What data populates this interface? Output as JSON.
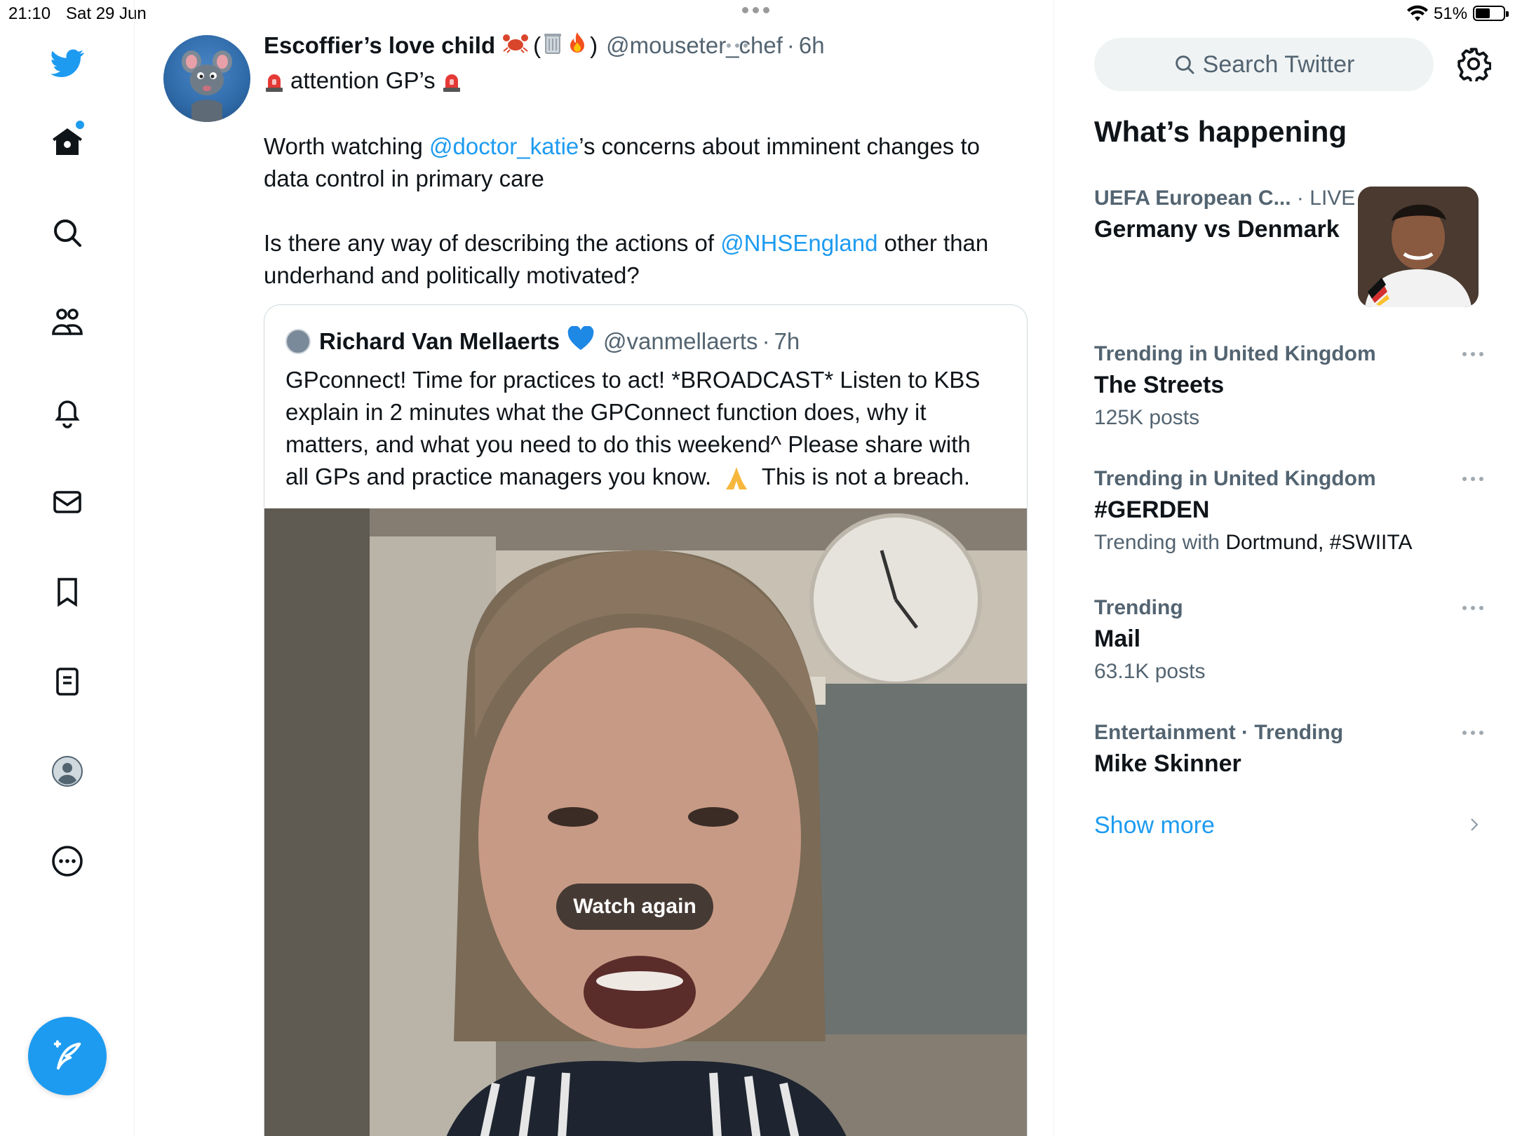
{
  "status_bar": {
    "time": "21:10",
    "date": "Sat 29 Jun",
    "battery": "51%",
    "battery_level": 0.51
  },
  "nav": {
    "items": [
      "twitter-logo",
      "home",
      "explore",
      "communities",
      "notifications",
      "messages",
      "bookmarks",
      "lists",
      "profile",
      "more"
    ],
    "accent": "#1d9bf0"
  },
  "tweet": {
    "author_name": "Escoffier’s love child",
    "author_handle": "@mouseter_chef",
    "time": "6h",
    "line1": "attention GP’s",
    "line2_pre": "Worth watching ",
    "line2_mention": "@doctor_katie",
    "line2_post": "’s concerns about imminent changes to",
    "line3": "data control in primary care",
    "line4_pre": "Is there any way of describing the actions of ",
    "line4_mention": "@NHSEngland",
    "line4_post": " other than",
    "line5": "underhand and politically motivated?"
  },
  "quote": {
    "author_name": "Richard Van Mellaerts",
    "author_handle": "@vanmellaerts",
    "time": "7h",
    "lines": [
      "GPconnect! Time for practices to act! *BROADCAST* Listen to KBS",
      "explain in 2 minutes what the GPConnect function does, why it",
      "matters, and what you need to do this weekend^ Please share with",
      "all GPs and practice managers you know.",
      " This is not a breach."
    ],
    "video_button": "Watch again"
  },
  "sidebar": {
    "search_placeholder": "Search Twitter",
    "section_title": "What’s happening",
    "trends": [
      {
        "context": "UEFA European C...",
        "context_extra": "LIVE",
        "title": "Germany vs Denmark",
        "sub": ""
      },
      {
        "context": "Trending in United Kingdom",
        "title": "The Streets",
        "sub": "125K posts"
      },
      {
        "context": "Trending in United Kingdom",
        "title": "#GERDEN",
        "sub_pre": "Trending with ",
        "sub_dark": "Dortmund, #SWIITA"
      },
      {
        "context": "Trending",
        "title": "Mail",
        "sub": "63.1K posts"
      },
      {
        "context": "Entertainment · Trending",
        "title": "Mike Skinner",
        "sub": ""
      }
    ],
    "show_more": "Show more"
  }
}
